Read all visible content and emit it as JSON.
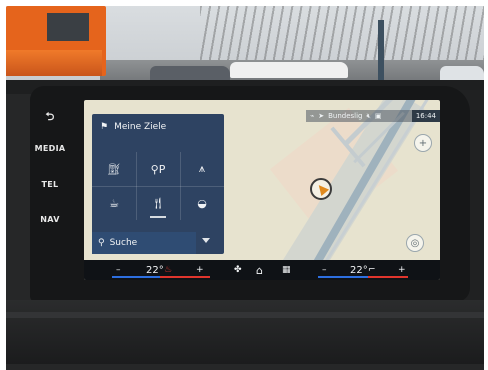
{
  "screen": {
    "status_bar": {
      "road_name": "Bundeslig",
      "time": "16:44"
    },
    "destinations_panel": {
      "title": "Meine Ziele",
      "poi_icons": [
        "fuel-icon",
        "parking-search-icon",
        "picnic-table-icon",
        "coffee-icon",
        "restaurant-icon",
        "fast-food-icon"
      ],
      "search_label": "Suche"
    },
    "climate_bar": {
      "left_minus": "–",
      "left_temp": "22°",
      "left_plus": "+",
      "right_minus": "–",
      "right_temp": "22°",
      "right_plus": "+"
    }
  },
  "side_buttons": {
    "back_glyph": "⮌",
    "media": "MEDIA",
    "tel": "TEL",
    "nav": "NAV"
  },
  "colors": {
    "map_background": "#e7e3cf",
    "panel_background": "#243a5c",
    "route_road": "#9fb2bd",
    "position_arrow": "#e08a1e",
    "temp_cold": "#2d6fe0",
    "temp_warm": "#e0352d"
  }
}
